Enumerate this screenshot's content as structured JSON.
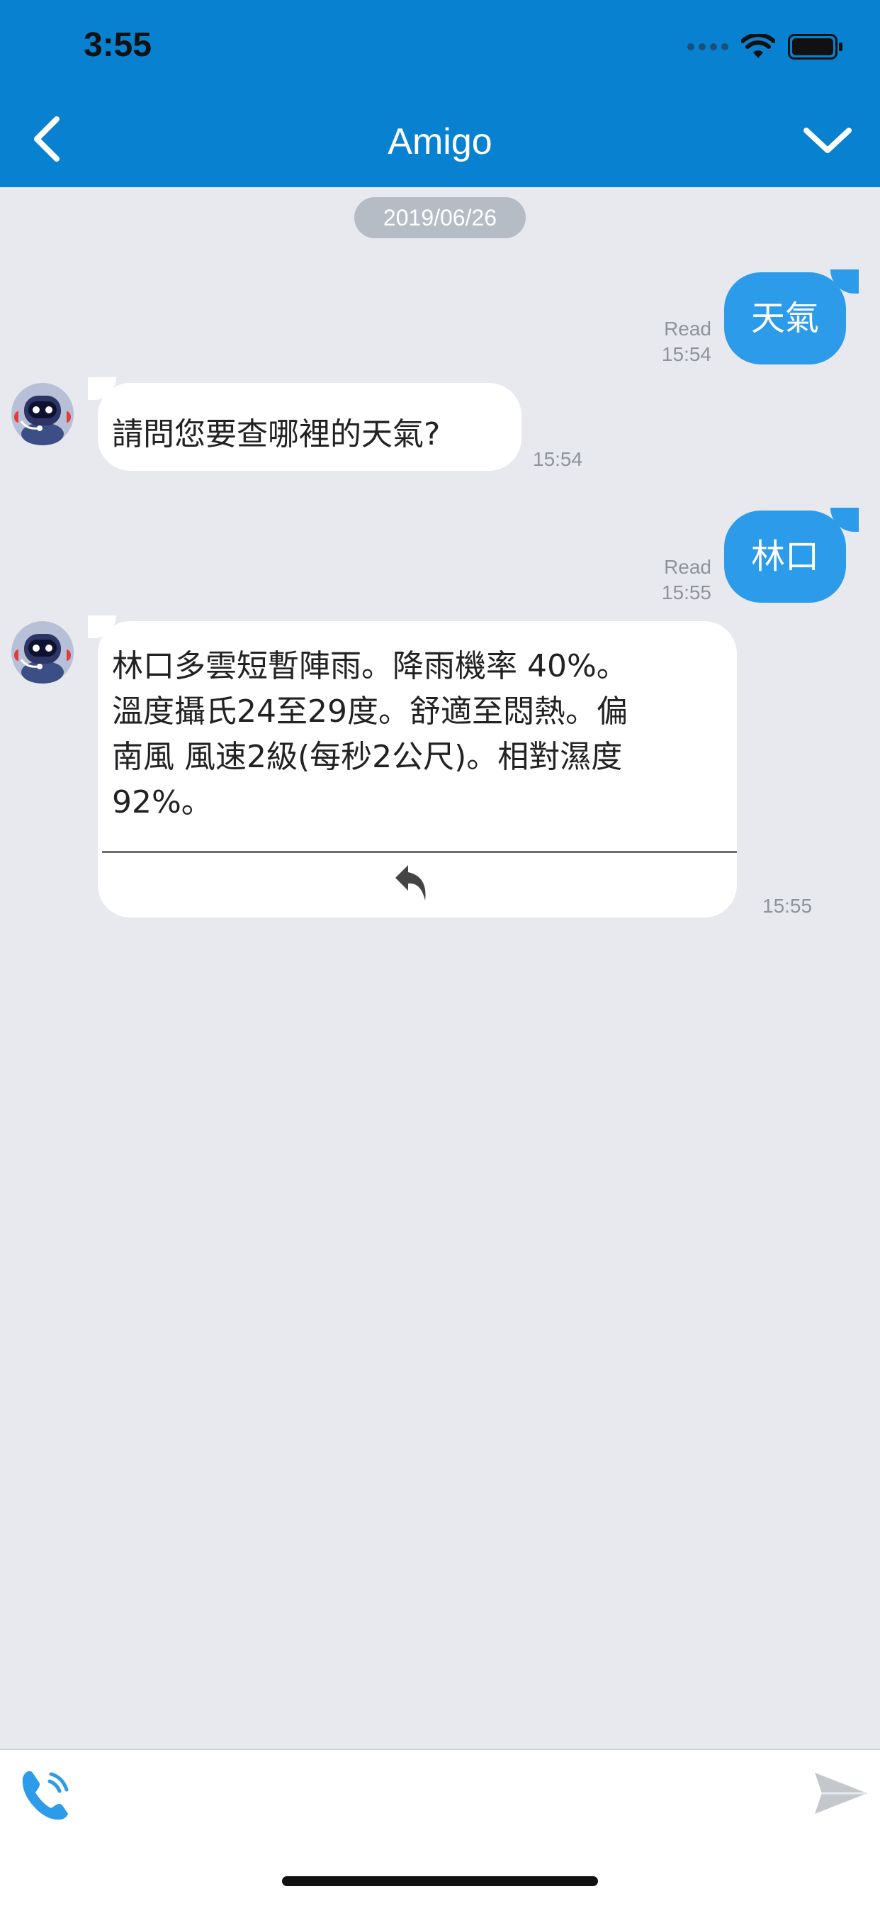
{
  "status_bar": {
    "time": "3:55"
  },
  "header": {
    "title": "Amigo"
  },
  "chat": {
    "date": "2019/06/26",
    "messages": [
      {
        "from": "user",
        "text": "天氣",
        "status": "Read",
        "time": "15:54"
      },
      {
        "from": "bot",
        "text": "請問您要查哪裡的天氣?",
        "time": "15:54"
      },
      {
        "from": "user",
        "text": "林口",
        "status": "Read",
        "time": "15:55"
      },
      {
        "from": "bot",
        "lines": [
          "林口多雲短暫陣雨。降雨機率 40%。",
          "溫度攝氏24至29度。舒適至悶熱。偏",
          "南風 風速2級(每秒2公尺)。相對濕度",
          "92%。"
        ],
        "time": "15:55"
      }
    ]
  },
  "input": {
    "value": "",
    "placeholder": ""
  },
  "colors": {
    "header": "#0781D0",
    "outgoing_bubble": "#2B9BEA",
    "background": "#E8E9EE"
  }
}
